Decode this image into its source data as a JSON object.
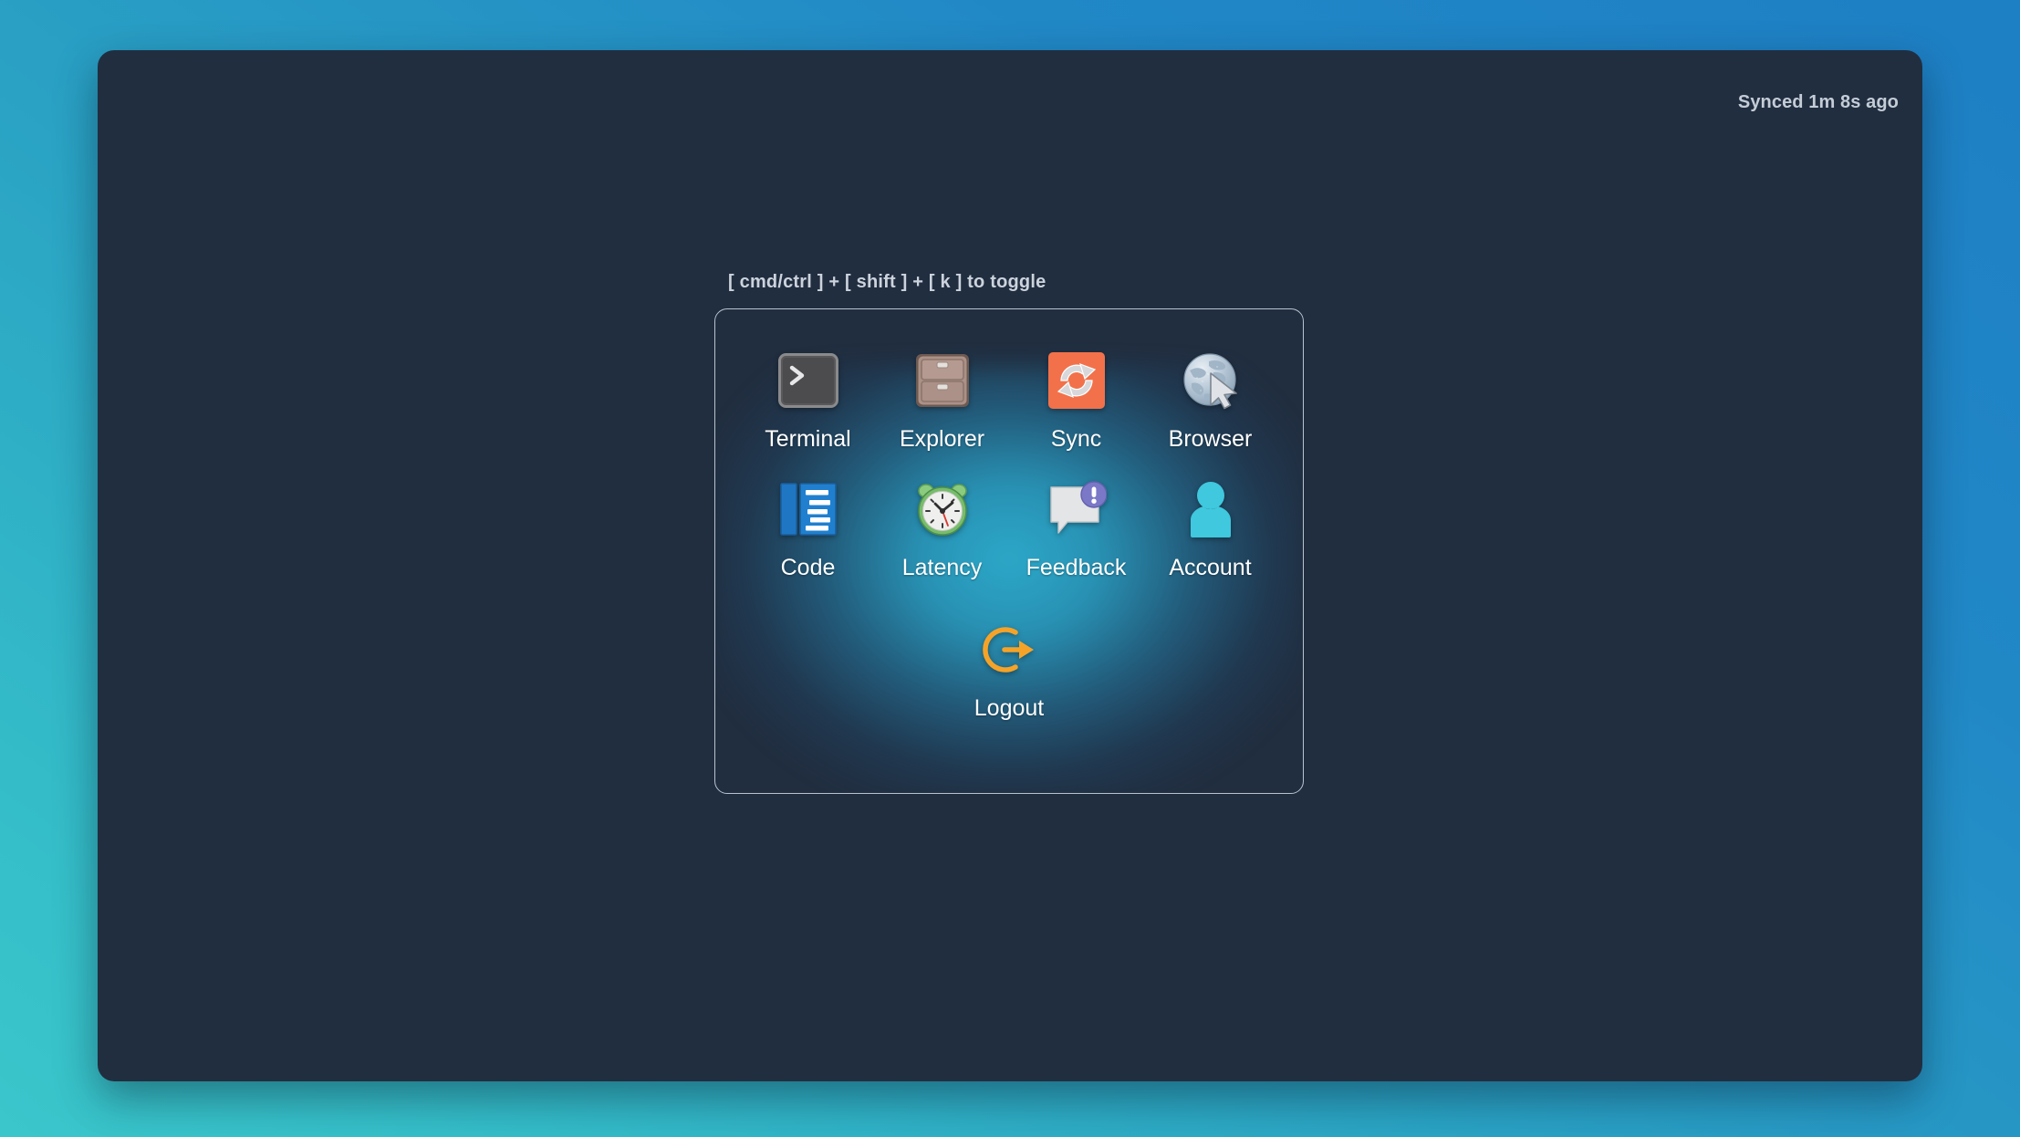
{
  "window": {
    "sync_status": "Synced 1m 8s ago"
  },
  "launcher": {
    "hint": "[ cmd/ctrl ] + [ shift ] + [ k ] to toggle",
    "items": [
      {
        "label": "Terminal",
        "icon": "terminal-icon"
      },
      {
        "label": "Explorer",
        "icon": "file-cabinet-icon"
      },
      {
        "label": "Sync",
        "icon": "sync-arrows-icon"
      },
      {
        "label": "Browser",
        "icon": "globe-cursor-icon"
      },
      {
        "label": "Code",
        "icon": "code-editor-icon"
      },
      {
        "label": "Latency",
        "icon": "alarm-clock-icon"
      },
      {
        "label": "Feedback",
        "icon": "speech-bubble-alert-icon"
      },
      {
        "label": "Account",
        "icon": "user-silhouette-icon"
      },
      {
        "label": "Logout",
        "icon": "logout-arrow-icon"
      }
    ]
  },
  "colors": {
    "desktop_gradient_start": "#1d7fc4",
    "desktop_gradient_end": "#3ac6cb",
    "window_background": "#212e40",
    "panel_glow": "#2dafd0",
    "sync_orange": "#f2714a",
    "logout_orange": "#f5a328",
    "code_blue": "#1f77c4",
    "account_cyan": "#3fc8de",
    "clock_green": "#7ac474",
    "feedback_purple": "#7b78c8"
  }
}
